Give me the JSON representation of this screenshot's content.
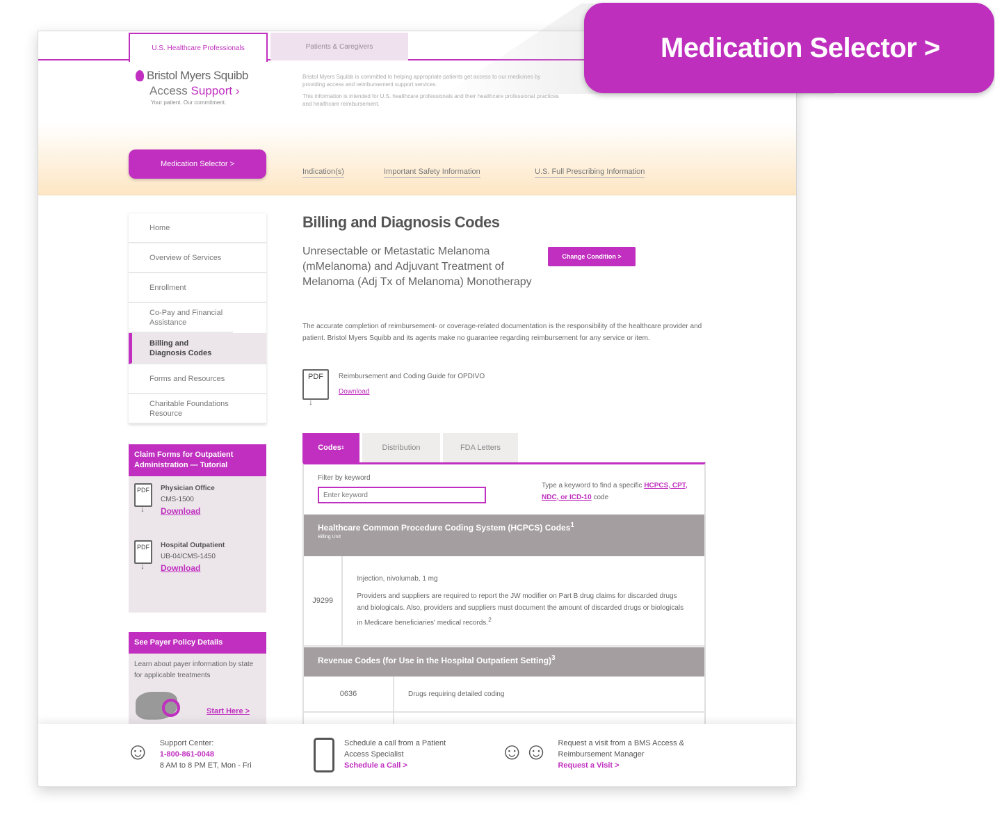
{
  "audience_tabs": {
    "active": "U.S. Healthcare Professionals",
    "inactive": "Patients & Caregivers"
  },
  "header": {
    "brand": "Bristol Myers Squibb",
    "access": "Access",
    "support": "Support",
    "tagline": "Your patient. Our commitment.",
    "description_1": "Bristol Myers Squibb is committed to helping appropriate patients get access to our medicines by providing access and reimbursement support services.",
    "description_2": "This information is intended for U.S. healthcare professionals and their healthcare professional practices and healthcare reimbursement."
  },
  "band": {
    "medication_selector": "Medication Selector >",
    "links": [
      "Indication(s)",
      "Important Safety Information",
      "U.S. Full Prescribing Information"
    ]
  },
  "nav": {
    "items": [
      "Home",
      "Overview of Services",
      "Enrollment",
      "Co-Pay and Financial Assistance",
      "Billing and Diagnosis Codes",
      "Forms and Resources",
      "Charitable Foundations Resource"
    ]
  },
  "claim_box": {
    "title": "Claim Forms for Outpatient Administration — Tutorial",
    "items": [
      {
        "pdf": "PDF",
        "line1": "Physician Office",
        "line2": "CMS-1500",
        "download": "Download"
      },
      {
        "pdf": "PDF",
        "line1": "Hospital Outpatient",
        "line2": "UB-04/CMS-1450",
        "download": "Download"
      }
    ]
  },
  "payer_box": {
    "title": "See Payer Policy Details",
    "text": "Learn about payer information by state for applicable treatments",
    "link": "Start Here >"
  },
  "main": {
    "title": "Billing and Diagnosis Codes",
    "condition": "Unresectable or Metastatic Melanoma (mMelanoma) and Adjuvant Treatment of Melanoma (Adj Tx of Melanoma) Monotherapy",
    "change_condition": "Change Condition >",
    "disclaimer": "The accurate completion of reimbursement- or coverage-related documentation is the responsibility of the healthcare provider and patient. Bristol Myers Squibb and its agents make no guarantee regarding reimbursement for any service or item.",
    "guide": {
      "pdf": "PDF",
      "label": "Reimbursement and Coding Guide for OPDIVO",
      "download": "Download"
    }
  },
  "code_tabs": [
    "Codes",
    "Distribution",
    "FDA Letters"
  ],
  "filter": {
    "label": "Filter by keyword",
    "placeholder": "Enter keyword",
    "hint_prefix": "Type a keyword to find a specific",
    "codes": "HCPCS, CPT, NDC, or ICD-10",
    "hint_suffix": "code"
  },
  "hcpcs": {
    "title": "Healthcare Common Procedure Coding System (HCPCS) Codes",
    "sup": "1",
    "sub": "Billing Unit",
    "code": "J9299",
    "desc_1": "Injection, nivolumab, 1 mg",
    "desc_2": "Providers and suppliers are required to report the JW modifier on Part B drug claims for discarded drugs and biologicals. Also, providers and suppliers must document the amount of discarded drugs or biologicals in Medicare beneficiaries' medical records.",
    "desc_sup": "2"
  },
  "revenue": {
    "title": "Revenue Codes (for Use in the Hospital Outpatient Setting)",
    "sup": "3",
    "code": "0636",
    "desc": "Drugs requiring detailed coding"
  },
  "footer": {
    "support_label": "Support Center:",
    "phone": "1-800-861-0048",
    "hours": "8 AM to 8 PM ET, Mon - Fri",
    "schedule_text": "Schedule a call from a Patient Access Specialist",
    "schedule_link": "Schedule a Call >",
    "visit_text": "Request a visit from a BMS Access & Reimbursement Manager",
    "visit_link": "Request a Visit >"
  },
  "callout": {
    "label": "Medication Selector >"
  },
  "colors": {
    "accent": "#c02fbf",
    "band": "#fde6c4",
    "section_head": "#a49ea0"
  }
}
